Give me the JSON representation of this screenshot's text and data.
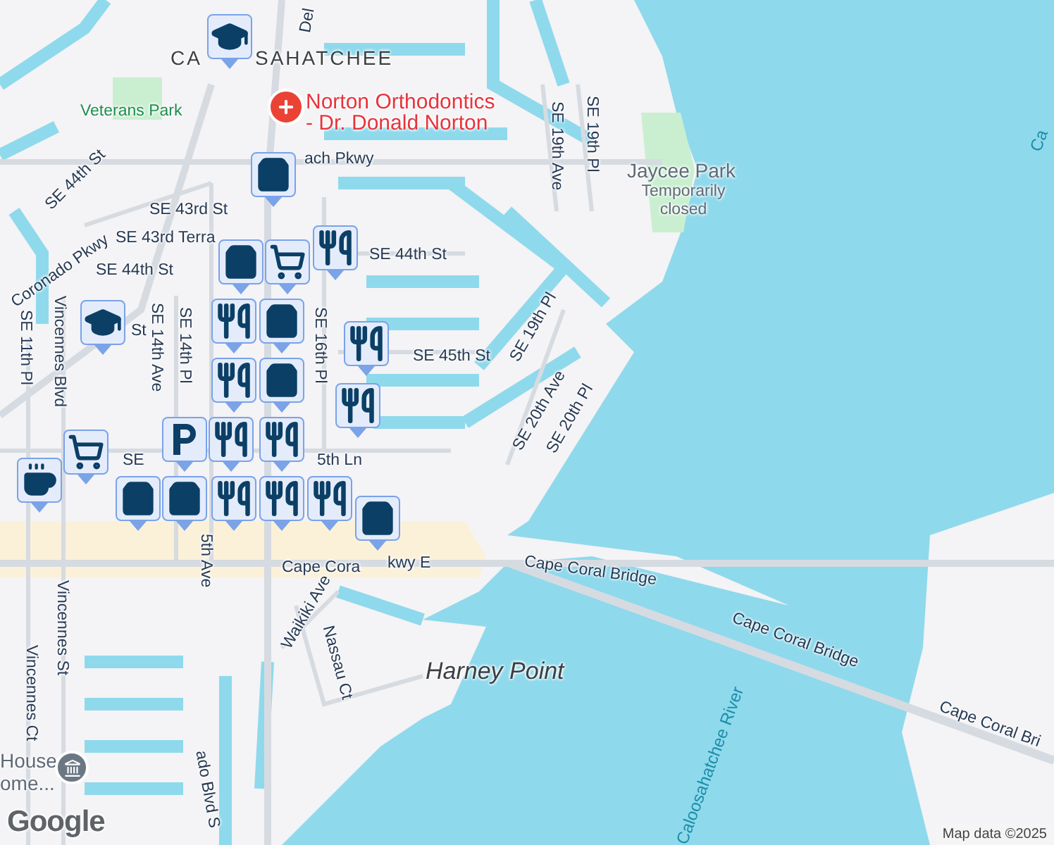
{
  "labels": [
    {
      "text": "Del",
      "kind": "street"
    },
    {
      "text": "CA",
      "kind": "area"
    },
    {
      "text": "SAHATCHEE",
      "kind": "area"
    },
    {
      "text": "Veterans Park",
      "kind": "park"
    },
    {
      "text": "Norton Orthodontics",
      "kind": "poi"
    },
    {
      "text": "- Dr. Donald Norton",
      "kind": "poi"
    },
    {
      "text": "ach Pkwy",
      "kind": "street"
    },
    {
      "text": "SE 44th St",
      "kind": "street"
    },
    {
      "text": "SE 43rd St",
      "kind": "street"
    },
    {
      "text": "SE 43rd Terra",
      "kind": "street"
    },
    {
      "text": "SE 44th St",
      "kind": "street"
    },
    {
      "text": "SE 44th St",
      "kind": "street"
    },
    {
      "text": "Coronado Pkwy",
      "kind": "street"
    },
    {
      "text": "SE 11th Pl",
      "kind": "street"
    },
    {
      "text": "Vincennes Blvd",
      "kind": "street"
    },
    {
      "text": "St",
      "kind": "street"
    },
    {
      "text": "SE 14th Ave",
      "kind": "street"
    },
    {
      "text": "SE 14th Pl",
      "kind": "street"
    },
    {
      "text": "SE 16th Pl",
      "kind": "street"
    },
    {
      "text": "SE 45th St",
      "kind": "street"
    },
    {
      "text": "SE 19th Pl",
      "kind": "street"
    },
    {
      "text": "SE 20th Ave",
      "kind": "street"
    },
    {
      "text": "SE 20th Pl",
      "kind": "street"
    },
    {
      "text": "SE 19th Ave",
      "kind": "street"
    },
    {
      "text": "SE 19th Pl",
      "kind": "street"
    },
    {
      "text": "Jaycee Park",
      "kind": "place"
    },
    {
      "text": "Temporarily closed",
      "kind": "note"
    },
    {
      "text": "Ca",
      "kind": "water"
    },
    {
      "text": "SE",
      "kind": "street"
    },
    {
      "text": "5th Ln",
      "kind": "street"
    },
    {
      "text": "5th Ave",
      "kind": "street"
    },
    {
      "text": "Cape Cora",
      "kind": "street"
    },
    {
      "text": "kwy E",
      "kind": "street"
    },
    {
      "text": "Cape Coral Bridge",
      "kind": "street"
    },
    {
      "text": "Cape Coral Bridge",
      "kind": "street"
    },
    {
      "text": "Cape Coral Bri",
      "kind": "street"
    },
    {
      "text": "Waikiki Ave",
      "kind": "street"
    },
    {
      "text": "Nassau Ct",
      "kind": "street"
    },
    {
      "text": "Harney Point",
      "kind": "area-italic"
    },
    {
      "text": "Vincennes St",
      "kind": "street"
    },
    {
      "text": "Vincennes Ct",
      "kind": "street"
    },
    {
      "text": "House",
      "kind": "place"
    },
    {
      "text": "ome...",
      "kind": "place"
    },
    {
      "text": "ado Blvd S",
      "kind": "street"
    },
    {
      "text": "Caloosahatchee River",
      "kind": "water"
    }
  ],
  "markers": [
    {
      "kind": "school"
    },
    {
      "kind": "school"
    },
    {
      "kind": "shop"
    },
    {
      "kind": "shop"
    },
    {
      "kind": "grocery"
    },
    {
      "kind": "restaurant"
    },
    {
      "kind": "restaurant"
    },
    {
      "kind": "shop"
    },
    {
      "kind": "restaurant"
    },
    {
      "kind": "shop"
    },
    {
      "kind": "grocery"
    },
    {
      "kind": "parking"
    },
    {
      "kind": "restaurant"
    },
    {
      "kind": "restaurant"
    },
    {
      "kind": "cafe"
    },
    {
      "kind": "shop"
    },
    {
      "kind": "shop"
    },
    {
      "kind": "restaurant"
    },
    {
      "kind": "restaurant"
    },
    {
      "kind": "restaurant"
    },
    {
      "kind": "shop"
    },
    {
      "kind": "restaurant"
    },
    {
      "kind": "restaurant"
    }
  ],
  "attribution": {
    "logo": "Google",
    "text": "Map data ©2025"
  }
}
